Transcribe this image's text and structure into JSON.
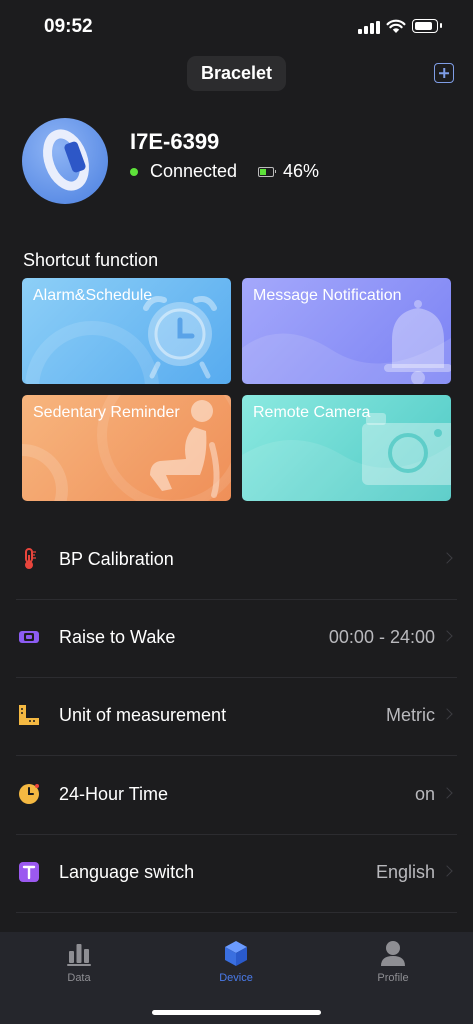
{
  "status_bar": {
    "time": "09:52"
  },
  "header": {
    "title": "Bracelet"
  },
  "device": {
    "name": "I7E-6399",
    "connection_status": "Connected",
    "battery": "46%",
    "battery_level": 0.46
  },
  "shortcuts": {
    "title": "Shortcut function",
    "items": [
      {
        "label": "Alarm&Schedule",
        "icon": "alarm-clock-icon"
      },
      {
        "label": "Message Notification",
        "icon": "bell-icon"
      },
      {
        "label": "Sedentary Reminder",
        "icon": "seated-person-icon"
      },
      {
        "label": "Remote Camera",
        "icon": "camera-icon"
      }
    ]
  },
  "settings": [
    {
      "label": "BP Calibration",
      "value": "",
      "icon": "thermometer-icon"
    },
    {
      "label": "Raise to Wake",
      "value": "00:00 - 24:00",
      "icon": "watch-icon"
    },
    {
      "label": "Unit of measurement",
      "value": "Metric",
      "icon": "ruler-icon"
    },
    {
      "label": "24-Hour Time",
      "value": "on",
      "icon": "clock-icon"
    },
    {
      "label": "Language switch",
      "value": "English",
      "icon": "language-icon"
    }
  ],
  "tab_bar": {
    "tabs": [
      {
        "label": "Data",
        "icon": "bar-chart-icon",
        "active": false
      },
      {
        "label": "Device",
        "icon": "cube-icon",
        "active": true
      },
      {
        "label": "Profile",
        "icon": "person-icon",
        "active": false
      }
    ]
  },
  "colors": {
    "background": "#1c1c1e",
    "accent": "#4a7bea",
    "connected": "#5ee23a",
    "inactive_tab": "#8e8e93"
  }
}
